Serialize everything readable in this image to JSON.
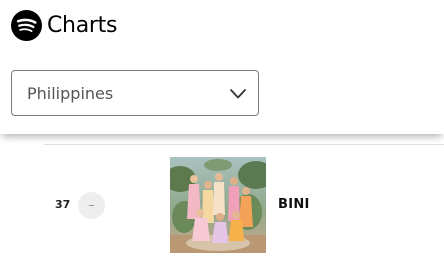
{
  "header": {
    "logo_icon": "spotify-logo-icon",
    "title": "Charts"
  },
  "country_select": {
    "value": "Philippines",
    "icon": "chevron-down-icon"
  },
  "chart_rows": [
    {
      "rank": "37",
      "movement": "–",
      "artist": "BINI",
      "cover_icon": "artist-photo"
    }
  ]
}
